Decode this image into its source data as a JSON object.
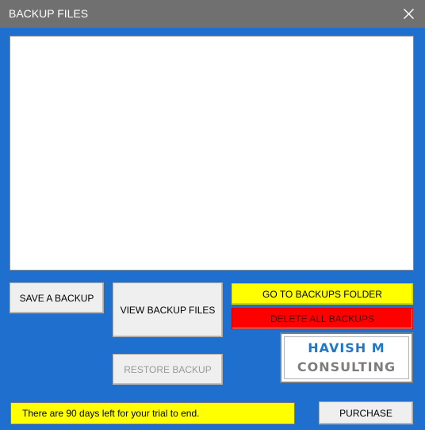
{
  "window": {
    "title": "BACKUP FILES"
  },
  "buttons": {
    "save": "SAVE A BACKUP",
    "view": "VIEW BACKUP FILES",
    "restore": "RESTORE BACKUP",
    "goto_folder": "GO TO BACKUPS FOLDER",
    "delete_all": "DELETE ALL BACKUPS",
    "purchase": "PURCHASE"
  },
  "logo": {
    "line1": "HAVISH M",
    "line2": "CONSULTING"
  },
  "trial": {
    "message": "There are 90 days left for your trial to end."
  },
  "colors": {
    "background": "#1e6fce",
    "titlebar": "#707070",
    "highlight_yellow": "#ffff00",
    "danger_red": "#ff0000",
    "logo_blue": "#1f77c8",
    "logo_gray": "#7d7d7d"
  }
}
